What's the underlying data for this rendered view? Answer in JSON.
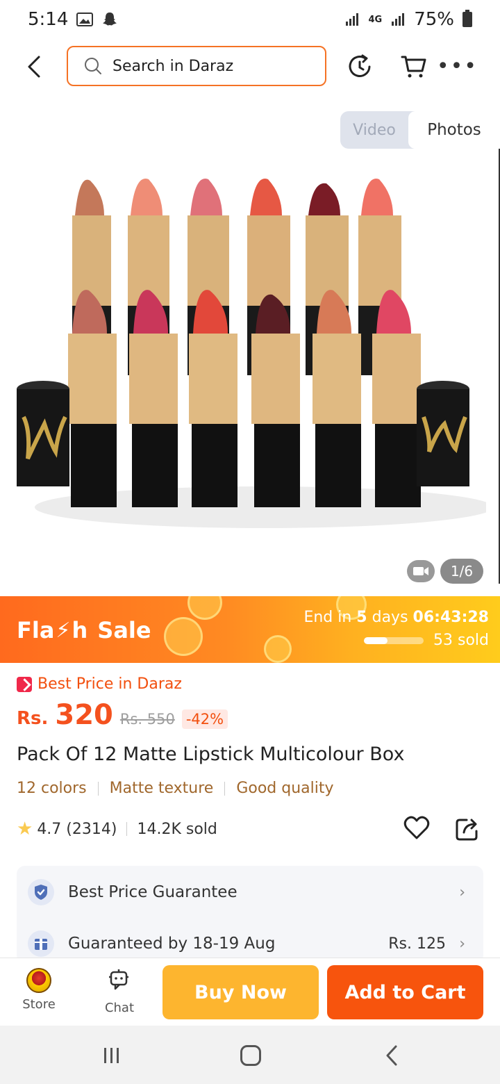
{
  "status_bar": {
    "time": "5:14",
    "network": "4G",
    "battery": "75%"
  },
  "header": {
    "search_placeholder": "Search in Daraz"
  },
  "media": {
    "tabs": [
      "Video",
      "Photos"
    ],
    "selected_tab": "Photos",
    "counter": "1/6"
  },
  "flash_sale": {
    "title_part1": "Fla",
    "title_part2": "h",
    "title_part3": "Sale",
    "end_prefix": "End in",
    "end_days": "5",
    "end_days_suffix": "days",
    "end_time": "06:43:28",
    "sold": "53 sold",
    "progress_fraction": 0.4
  },
  "price": {
    "best_price": "Best Price in Daraz",
    "currency": "Rs.",
    "current": "320",
    "original": "Rs. 550",
    "discount": "-42%"
  },
  "product": {
    "title": "Pack Of 12 Matte Lipstick Multicolour Box",
    "tags": [
      "12 colors",
      "Matte texture",
      "Good quality"
    ],
    "rating": "4.7 (2314)",
    "sold": "14.2K sold"
  },
  "services": {
    "guarantee": "Best Price Guarantee",
    "delivery": "Guaranteed by 18-19 Aug",
    "delivery_fee": "Rs. 125"
  },
  "bottom_bar": {
    "store": "Store",
    "chat": "Chat",
    "buy_now": "Buy Now",
    "add_to_cart": "Add to Cart"
  },
  "colors": {
    "accent": "#f57224",
    "buy_now": "#fdb52f",
    "add_to_cart": "#f7540d"
  }
}
